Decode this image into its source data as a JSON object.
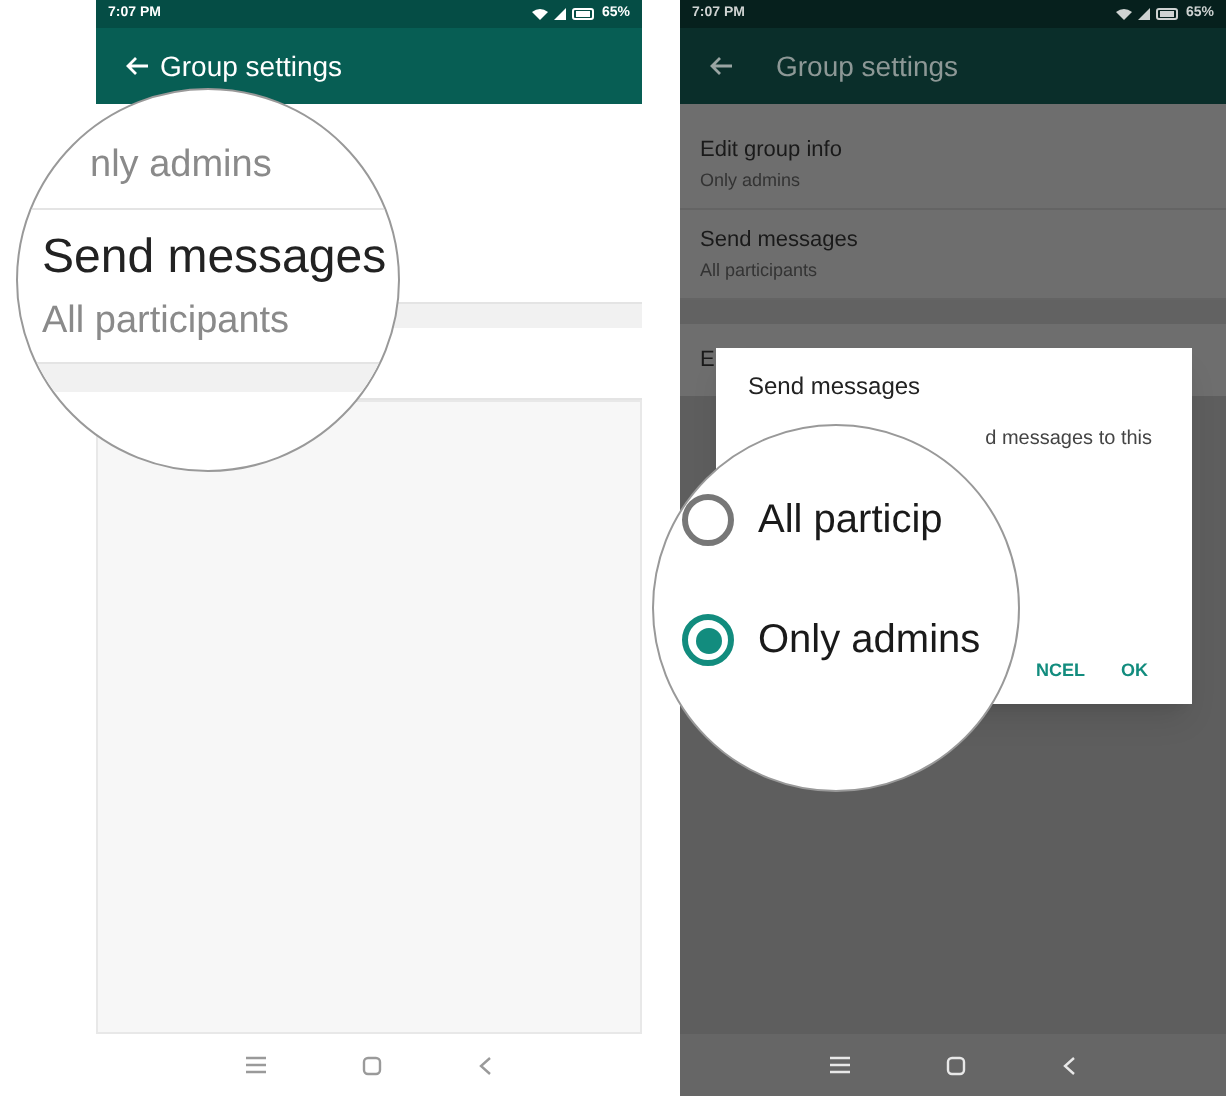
{
  "left_screen": {
    "status_bar": {
      "time": "7:07 PM",
      "battery": "65%"
    },
    "app_bar": {
      "title": "Group settings"
    },
    "magnifier": {
      "items": [
        {
          "subtitle": "nly admins"
        },
        {
          "title": "Send messages",
          "subtitle": "All participants"
        }
      ]
    }
  },
  "right_screen": {
    "status_bar": {
      "time": "7:07 PM",
      "battery": "65%"
    },
    "app_bar": {
      "title": "Group settings"
    },
    "settings": [
      {
        "title": "Edit group info",
        "subtitle": "Only admins"
      },
      {
        "title": "Send messages",
        "subtitle": "All participants"
      }
    ],
    "cut_item": "E",
    "dialog": {
      "title": "Send messages",
      "text": "d messages to this",
      "buttons": [
        "NCEL",
        "OK"
      ]
    },
    "magnifier": {
      "options": [
        {
          "label": "All particip",
          "selected": false
        },
        {
          "label": "Only admins",
          "selected": true
        }
      ]
    }
  }
}
